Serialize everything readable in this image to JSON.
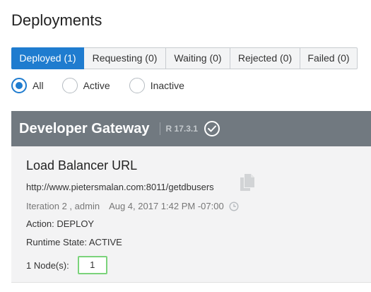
{
  "page": {
    "title": "Deployments"
  },
  "tabs": [
    {
      "label": "Deployed (1)",
      "active": true
    },
    {
      "label": "Requesting (0)",
      "active": false
    },
    {
      "label": "Waiting (0)",
      "active": false
    },
    {
      "label": "Rejected (0)",
      "active": false
    },
    {
      "label": "Failed (0)",
      "active": false
    }
  ],
  "filter": {
    "options": [
      {
        "label": "All",
        "selected": true
      },
      {
        "label": "Active",
        "selected": false
      },
      {
        "label": "Inactive",
        "selected": false
      }
    ]
  },
  "gateway": {
    "name": "Developer Gateway",
    "version": "R 17.3.1",
    "status_icon": "check-circle-icon",
    "header_color": "#717980",
    "deployment": {
      "section_title": "Load Balancer URL",
      "url": "http://www.pietersmalan.com:8011/getdbusers",
      "copy_icon": "copy-icon",
      "iteration": "Iteration 2 , admin",
      "date": "Aug 4, 2017 1:42 PM -07:00",
      "clock_icon": "clock-icon",
      "action": "Action: DEPLOY",
      "runtime_state": "Runtime State: ACTIVE",
      "nodes_label": "1 Node(s):",
      "nodes_value": "1"
    }
  },
  "colors": {
    "accent": "#1f7ccf",
    "node_border": "#7bd37b"
  }
}
